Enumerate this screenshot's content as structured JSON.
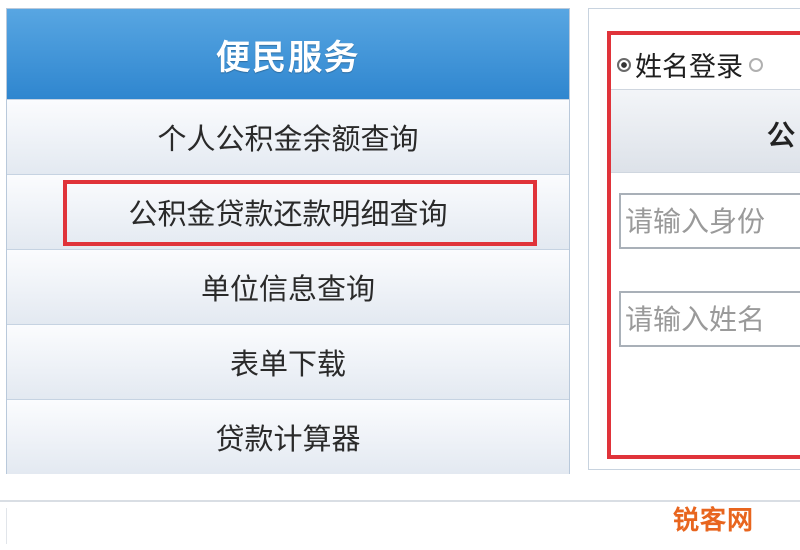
{
  "service_menu": {
    "title": "便民服务",
    "items": [
      {
        "label": "个人公积金余额查询",
        "highlighted": false
      },
      {
        "label": "公积金贷款还款明细查询",
        "highlighted": true
      },
      {
        "label": "单位信息查询",
        "highlighted": false
      },
      {
        "label": "表单下载",
        "highlighted": false
      },
      {
        "label": "贷款计算器",
        "highlighted": false
      }
    ]
  },
  "login_panel": {
    "mode_label": "姓名登录",
    "title": "公",
    "id_placeholder": "请输入身份",
    "name_placeholder": "请输入姓名"
  },
  "watermark": "锐客网",
  "colors": {
    "header_blue": "#2f86cf",
    "highlight_red": "#e0333a",
    "watermark_orange": "#e8651e"
  }
}
